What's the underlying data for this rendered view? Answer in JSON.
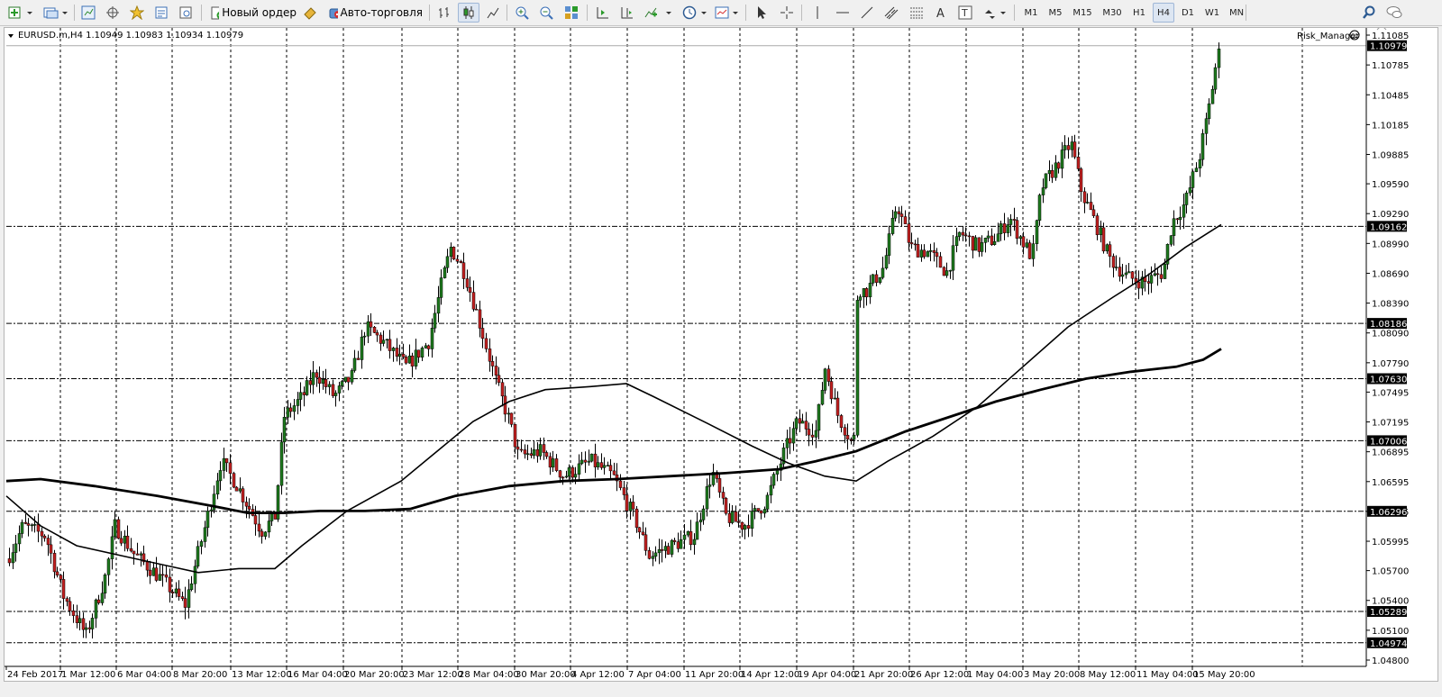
{
  "toolbar": {
    "new_order_label": "Новый ордер",
    "auto_trading_label": "Авто-торговля",
    "timeframes": [
      "M1",
      "M5",
      "M15",
      "M30",
      "H1",
      "H4",
      "D1",
      "W1",
      "MN"
    ],
    "active_timeframe": "H4"
  },
  "chart": {
    "header": "EURUSD.m,H4  1.10949 1.10983 1.10934 1.10979",
    "indicator_label": "Risk_Manager",
    "price_labels": [
      "1.11085",
      "1.10785",
      "1.10485",
      "1.10185",
      "1.09885",
      "1.09590",
      "1.09290",
      "1.08990",
      "1.08690",
      "1.08390",
      "1.08090",
      "1.07790",
      "1.07495",
      "1.07195",
      "1.06895",
      "1.06595",
      "1.06295",
      "1.05995",
      "1.05700",
      "1.05400",
      "1.05100",
      "1.04800"
    ],
    "level_labels": [
      "1.10979",
      "1.09162",
      "1.08186",
      "1.07630",
      "1.07006",
      "1.06296",
      "1.05289",
      "1.04974"
    ],
    "time_labels": [
      "24 Feb 2017",
      "1 Mar 12:00",
      "6 Mar 04:00",
      "8 Mar 20:00",
      "13 Mar 12:00",
      "16 Mar 04:00",
      "20 Mar 20:00",
      "23 Mar 12:00",
      "28 Mar 04:00",
      "30 Mar 20:00",
      "4 Apr 12:00",
      "7 Apr 04:00",
      "11 Apr 20:00",
      "14 Apr 12:00",
      "19 Apr 04:00",
      "21 Apr 20:00",
      "26 Apr 12:00",
      "1 May 04:00",
      "3 May 20:00",
      "8 May 12:00",
      "11 May 04:00",
      "15 May 20:00"
    ]
  },
  "colors": {
    "bull": "#1e7a1e",
    "bear": "#c42020",
    "ma": "#000000",
    "grid": "#000000"
  }
}
